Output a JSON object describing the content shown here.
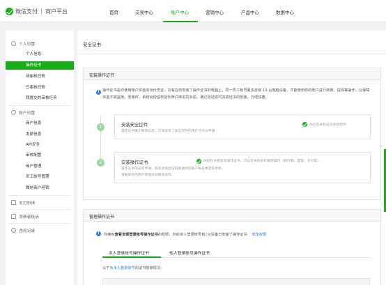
{
  "header": {
    "brand": "微信支付",
    "subbrand": "商户平台",
    "nav": [
      "首页",
      "交易中心",
      "账户中心",
      "营销中心",
      "产品中心",
      "数据中心"
    ],
    "active_nav": "账户中心"
  },
  "sidebar": {
    "group1": "个人设置",
    "group1_items": [
      "个人信息",
      "操作证书",
      "待审核任务",
      "已审核任务",
      "我提交的审核任务"
    ],
    "active_item": "操作证书",
    "group2": "账户设置",
    "group2_items": [
      "商户信息",
      "发薪信息",
      "API安全",
      "审核配置",
      "商户管理",
      "员工帐号管理",
      "微信商户经销"
    ],
    "group3": "支付申请",
    "group4": "消费者投诉",
    "group5": "违规记录"
  },
  "main": {
    "title": "安全证书",
    "install": {
      "header": "安装操作证书",
      "desc": "操作证书是你使用账户资金的身份凭证，只有在你安装了操作证书的电脑上，同一员工帐号最多安装 10 台电脑设备，才能使用你的账户进行转账、提现等操作，以保障资金不被盗用。安装时，系统会短信校验你账户绑定的手机，通过验证即可完成证书的安装，方便快捷。",
      "step1": {
        "num": "1",
        "title": "安装安全控件",
        "sub": "操作证书属于敏感信息，只有安装了安全控件的用户才可以申请",
        "status": "你已在本机成功安装控件"
      },
      "step2": {
        "num": "2",
        "title": "安装操作证书",
        "sub1": "操作证书的安装申请，系统会将验证码发送到您账户帐号绑定的手机，",
        "sub2": "请联系你的商户管理员获取验证码",
        "status": "你已在本机安装操作证书，可以在本机进行敏感操作（如付款、提现、支付等）"
      }
    },
    "manage": {
      "header": "管理操作证书",
      "info_prefix": "你拥有",
      "info_bold": "查看全部登录帐号操作证书",
      "info_mid": "的权限，你的本人登录帐号有",
      "info_count": "2",
      "info_suffix": "台设备已安装了操作证书",
      "info_link": "修改权限",
      "tab1": "本人登录帐号操作证书",
      "tab2": "他人登录帐号操作证书",
      "list_prefix": "以下为",
      "list_link": "本人登录帐号",
      "list_suffix": "的证书安装情况："
    }
  },
  "colors": {
    "accent": "#1aad19",
    "info": "#2a7fd4",
    "link": "#2a7fd4"
  }
}
